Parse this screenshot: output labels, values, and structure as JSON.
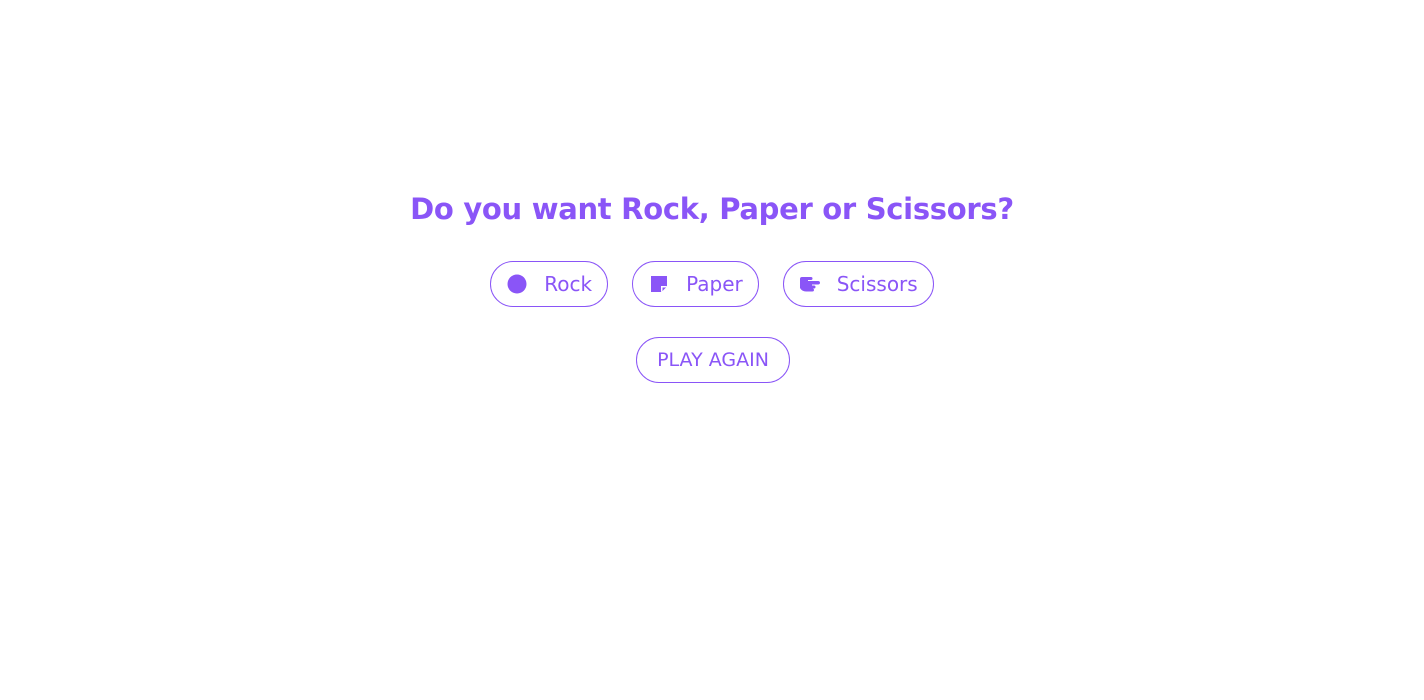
{
  "heading": "Do you want Rock, Paper or Scissors?",
  "choices": [
    {
      "label": "Rock",
      "icon": "circle-icon"
    },
    {
      "label": "Paper",
      "icon": "sticky-note-icon"
    },
    {
      "label": "Scissors",
      "icon": "hand-scissors-icon"
    }
  ],
  "play_again_label": "PLAY AGAIN",
  "colors": {
    "accent": "#8a55f7",
    "background": "#ffffff"
  }
}
